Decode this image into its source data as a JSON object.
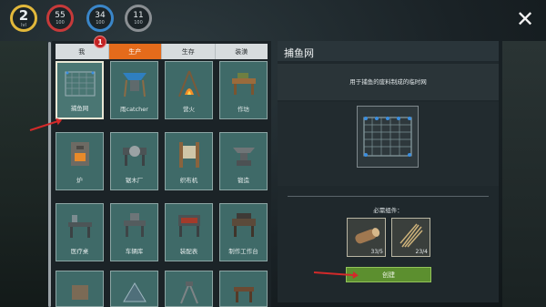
{
  "stats": {
    "level": {
      "value": "2",
      "label": "lvl"
    },
    "health": {
      "value": "55",
      "max": "100"
    },
    "food": {
      "value": "34",
      "max": "100"
    },
    "water": {
      "value": "11",
      "max": "100"
    }
  },
  "tabs": [
    {
      "label": "我"
    },
    {
      "label": "生产"
    },
    {
      "label": "生存"
    },
    {
      "label": "装潢"
    }
  ],
  "active_tab": "生产",
  "badge_count": "1",
  "recipes": [
    {
      "label": "捕鱼网",
      "icon": "fishing-net-icon"
    },
    {
      "label": "雨catcher",
      "icon": "rain-catcher-icon"
    },
    {
      "label": "营火",
      "icon": "campfire-icon"
    },
    {
      "label": "作坊",
      "icon": "workshop-icon"
    },
    {
      "label": "炉",
      "icon": "furnace-icon"
    },
    {
      "label": "锯木厂",
      "icon": "sawmill-icon"
    },
    {
      "label": "织布机",
      "icon": "loom-icon"
    },
    {
      "label": "锻造",
      "icon": "anvil-icon"
    },
    {
      "label": "医疗桌",
      "icon": "medical-table-icon"
    },
    {
      "label": "车辆库",
      "icon": "vehicle-bench-icon"
    },
    {
      "label": "装配表",
      "icon": "assembly-bench-icon"
    },
    {
      "label": "制作工作台",
      "icon": "crafting-table-icon"
    },
    {
      "label": "",
      "icon": "item-icon"
    },
    {
      "label": "",
      "icon": "tent-icon"
    },
    {
      "label": "",
      "icon": "tripod-icon"
    },
    {
      "label": "",
      "icon": "table-icon"
    }
  ],
  "detail": {
    "title": "捕鱼网",
    "description": "用于捕鱼的废料制成的临时网",
    "required_label": "必需组件：",
    "materials": [
      {
        "count": "33/5",
        "icon": "wood-log-icon"
      },
      {
        "count": "23/4",
        "icon": "fiber-icon"
      }
    ],
    "build_label": "创建"
  },
  "colors": {
    "accent": "#e46b1b",
    "build": "#5c8f2f",
    "card": "#3f6a68"
  }
}
